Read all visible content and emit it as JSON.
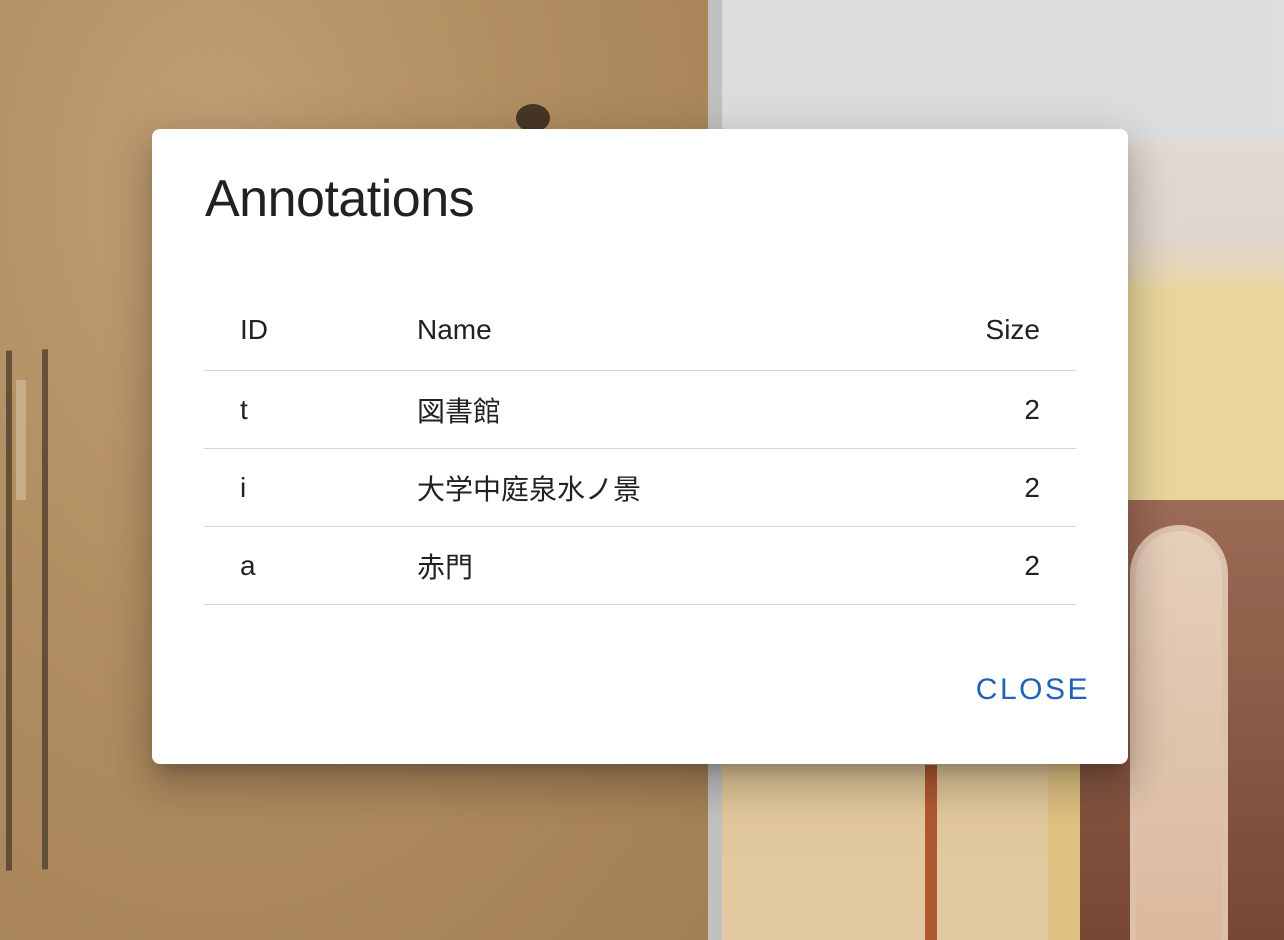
{
  "dialog": {
    "title": "Annotations",
    "close_label": "CLOSE"
  },
  "table": {
    "headers": {
      "id": "ID",
      "name": "Name",
      "size": "Size"
    },
    "rows": [
      {
        "id": "t",
        "name": "図書館",
        "size": "2"
      },
      {
        "id": "i",
        "name": "大学中庭泉水ノ景",
        "size": "2"
      },
      {
        "id": "a",
        "name": "赤門",
        "size": "2"
      }
    ]
  },
  "colors": {
    "accent": "#1e63b8",
    "divider": "#d6d6d6",
    "text": "#212121"
  }
}
